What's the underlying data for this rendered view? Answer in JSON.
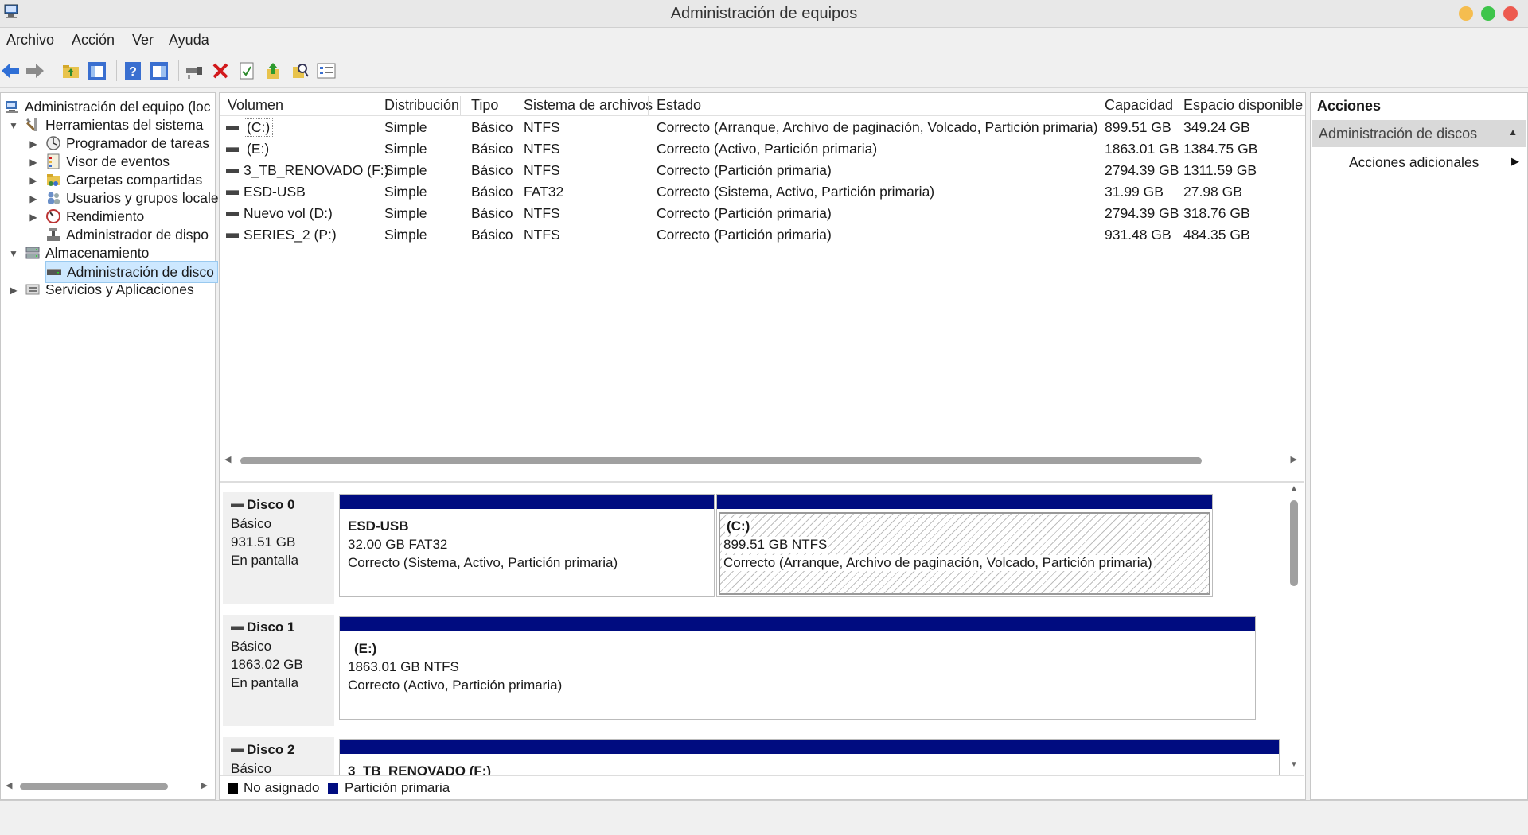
{
  "window": {
    "title": "Administración de equipos"
  },
  "menu": [
    "Archivo",
    "Acción",
    "Ver",
    "Ayuda"
  ],
  "tree": {
    "root": "Administración del equipo (loc",
    "system_tools": "Herramientas del sistema",
    "task_scheduler": "Programador de tareas",
    "event_viewer": "Visor de eventos",
    "shared_folders": "Carpetas compartidas",
    "users_groups": "Usuarios y grupos locale",
    "performance": "Rendimiento",
    "device_manager": "Administrador de dispo",
    "storage": "Almacenamiento",
    "disk_management": "Administración de disco",
    "services_apps": "Servicios y Aplicaciones"
  },
  "volumes": {
    "headers": [
      "Volumen",
      "Distribución",
      "Tipo",
      "Sistema de archivos",
      "Estado",
      "Capacidad",
      "Espacio disponible"
    ],
    "rows": [
      [
        "(C:)",
        "Simple",
        "Básico",
        "NTFS",
        "Correcto (Arranque, Archivo de paginación, Volcado, Partición primaria)",
        "899.51 GB",
        "349.24 GB"
      ],
      [
        "(E:)",
        "Simple",
        "Básico",
        "NTFS",
        "Correcto (Activo, Partición primaria)",
        "1863.01 GB",
        "1384.75 GB"
      ],
      [
        "3_TB_RENOVADO (F:)",
        "Simple",
        "Básico",
        "NTFS",
        "Correcto (Partición primaria)",
        "2794.39 GB",
        "1311.59 GB"
      ],
      [
        "ESD-USB",
        "Simple",
        "Básico",
        "FAT32",
        "Correcto (Sistema, Activo, Partición primaria)",
        "31.99 GB",
        "27.98 GB"
      ],
      [
        "Nuevo vol (D:)",
        "Simple",
        "Básico",
        "NTFS",
        "Correcto (Partición primaria)",
        "2794.39 GB",
        "318.76 GB"
      ],
      [
        "SERIES_2 (P:)",
        "Simple",
        "Básico",
        "NTFS",
        "Correcto (Partición primaria)",
        "931.48 GB",
        "484.35 GB"
      ]
    ]
  },
  "disks": [
    {
      "name": "Disco 0",
      "type": "Básico",
      "size": "931.51 GB",
      "status": "En pantalla",
      "partitions": [
        {
          "name": "ESD-USB",
          "detail": "32.00 GB FAT32",
          "status": "Correcto (Sistema, Activo, Partición primaria)"
        },
        {
          "name": "(C:)",
          "detail": "899.51 GB NTFS",
          "status": "Correcto (Arranque, Archivo de paginación, Volcado, Partición primaria)"
        }
      ]
    },
    {
      "name": "Disco 1",
      "type": "Básico",
      "size": "1863.02 GB",
      "status": "En pantalla",
      "partitions": [
        {
          "name": "(E:)",
          "detail": "1863.01 GB NTFS",
          "status": "Correcto (Activo, Partición primaria)"
        }
      ]
    },
    {
      "name": "Disco 2",
      "type": "Básico",
      "partitions": [
        {
          "name": "3_TB_RENOVADO (F:)"
        }
      ]
    }
  ],
  "legend": {
    "unallocated": "No asignado",
    "primary": "Partición primaria"
  },
  "actions": {
    "title": "Acciones",
    "section": "Administración de discos",
    "more": "Acciones adicionales"
  },
  "colors": {
    "partition_bar": "#000c80",
    "unallocated": "#000000",
    "selection": "#cde8ff"
  }
}
